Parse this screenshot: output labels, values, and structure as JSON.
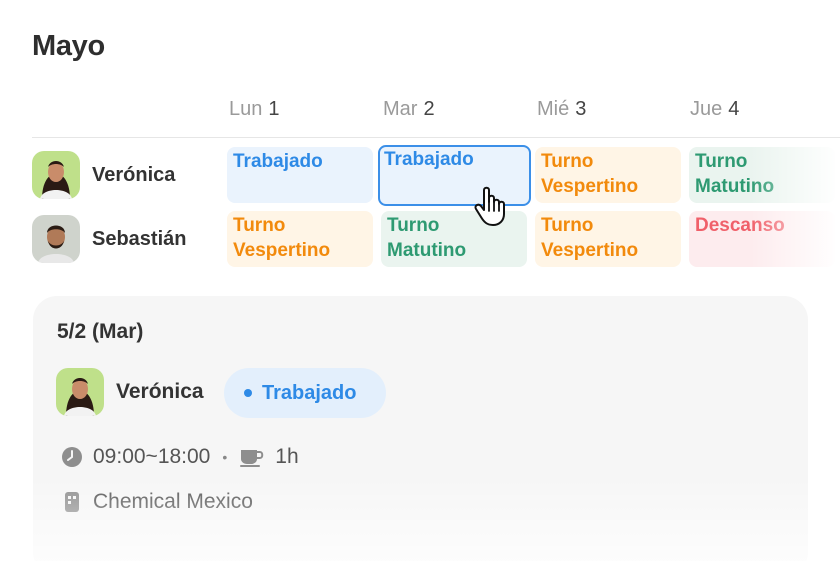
{
  "month": "Mayo",
  "days": [
    {
      "name": "Lun",
      "num": "1"
    },
    {
      "name": "Mar",
      "num": "2"
    },
    {
      "name": "Mié",
      "num": "3"
    },
    {
      "name": "Jue",
      "num": "4"
    }
  ],
  "employees": [
    {
      "name": "Verónica",
      "shifts": [
        {
          "label": "Trabajado",
          "type": "worked"
        },
        {
          "label": "Trabajado",
          "type": "worked",
          "selected": true
        },
        {
          "label": "Turno Vespertino",
          "type": "evening"
        },
        {
          "label": "Turno Matutino",
          "type": "morning"
        }
      ]
    },
    {
      "name": "Sebastián",
      "shifts": [
        {
          "label": "Turno Vespertino",
          "type": "evening"
        },
        {
          "label": "Turno Matutino",
          "type": "morning"
        },
        {
          "label": "Turno Vespertino",
          "type": "evening"
        },
        {
          "label": "Descanso",
          "type": "rest"
        }
      ]
    }
  ],
  "colors": {
    "worked": "#2e8ae6",
    "evening": "#f28a0c",
    "morning": "#2e9a72",
    "rest": "#f0606a",
    "selection_border": "#3b8fe8"
  },
  "detail": {
    "date": "5/2 (Mar)",
    "employee": "Verónica",
    "status": "Trabajado",
    "time_range": "09:00~18:00",
    "separator": "•",
    "break": "1h",
    "location": "Chemical Mexico",
    "icons": [
      "clock-icon",
      "coffee-cup-icon",
      "building-icon"
    ]
  }
}
